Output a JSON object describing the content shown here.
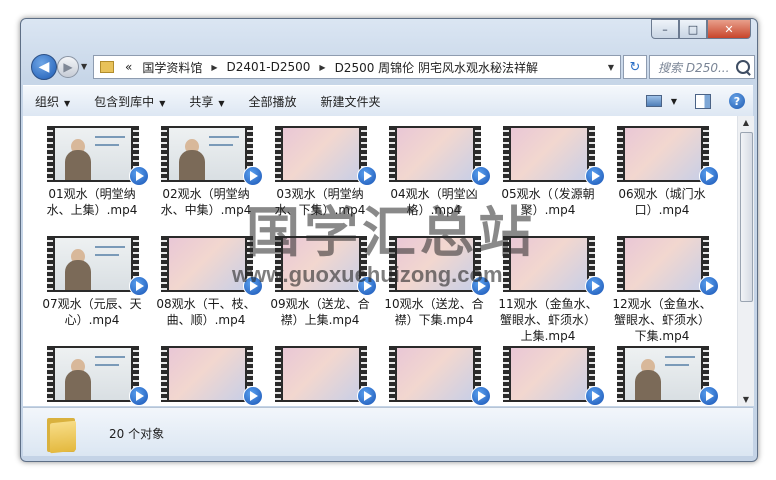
{
  "window": {
    "controls": {
      "minimize": "–",
      "maximize": "□",
      "close": "✕"
    }
  },
  "nav": {
    "back_icon": "◀",
    "forward_icon": "▶",
    "breadcrumb_prefix": "«",
    "breadcrumb": [
      "国学资料馆",
      "D2401-D2500",
      "D2500 周锦伦 阴宅风水观水秘法祥解"
    ],
    "search_placeholder": "搜索 D250...",
    "refresh_icon": "↻"
  },
  "toolbar": {
    "items": [
      "组织",
      "包含到库中",
      "共享",
      "全部播放",
      "新建文件夹"
    ]
  },
  "files": [
    {
      "name": "01观水（明堂纳水、上集）.mp4",
      "thumb": "lecture"
    },
    {
      "name": "02观水（明堂纳水、中集）.mp4",
      "thumb": "lecture"
    },
    {
      "name": "03观水（明堂纳水、下集）.mp4",
      "thumb": "gradient"
    },
    {
      "name": "04观水（明堂凶格）.mp4",
      "thumb": "gradient"
    },
    {
      "name": "05观水（（发源朝聚）.mp4",
      "thumb": "gradient"
    },
    {
      "name": "06观水（城门水口）.mp4",
      "thumb": "gradient"
    },
    {
      "name": "07观水（元辰、天心）.mp4",
      "thumb": "lecture"
    },
    {
      "name": "08观水（干、枝、曲、顺）.mp4",
      "thumb": "gradient"
    },
    {
      "name": "09观水（送龙、合襟）上集.mp4",
      "thumb": "gradient"
    },
    {
      "name": "10观水（送龙、合襟）下集.mp4",
      "thumb": "gradient"
    },
    {
      "name": "11观水（金鱼水、蟹眼水、虾须水）上集.mp4",
      "thumb": "gradient"
    },
    {
      "name": "12观水（金鱼水、蟹眼水、虾须水）下集.mp4",
      "thumb": "gradient"
    },
    {
      "name": "",
      "thumb": "lecture"
    },
    {
      "name": "",
      "thumb": "gradient"
    },
    {
      "name": "",
      "thumb": "gradient"
    },
    {
      "name": "",
      "thumb": "gradient"
    },
    {
      "name": "",
      "thumb": "gradient"
    },
    {
      "name": "",
      "thumb": "lecture"
    }
  ],
  "status": {
    "count_text": "20 个对象"
  },
  "watermark": {
    "chinese": "国学汇总站",
    "url": "www.guoxuehuizong.com"
  }
}
